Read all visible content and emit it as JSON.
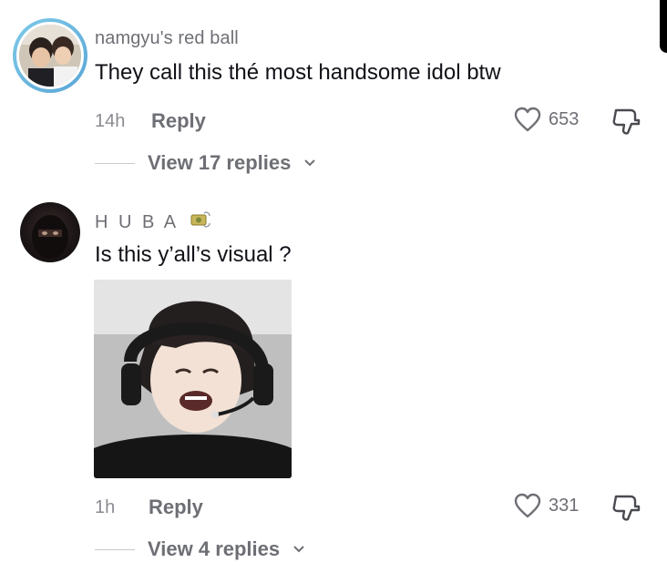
{
  "comments": [
    {
      "username": "namgyu's red ball",
      "text": "They call this thé most handsome idol btw",
      "time": "14h",
      "reply_label": "Reply",
      "likes": "653",
      "view_replies": "View 17 replies"
    },
    {
      "username": "H U B A",
      "text": "Is this y’all’s visual ?",
      "time": "1h",
      "reply_label": "Reply",
      "likes": "331",
      "view_replies": "View 4 replies"
    }
  ],
  "icons": {
    "like": "heart-icon",
    "dislike": "thumbs-down-icon",
    "expand": "chevron-down-icon",
    "username_emoji": "money-with-wings-icon"
  },
  "colors": {
    "avatar_ring": "#6bb8e0",
    "secondary_text": "#6e6f75",
    "primary_text": "#111218"
  }
}
